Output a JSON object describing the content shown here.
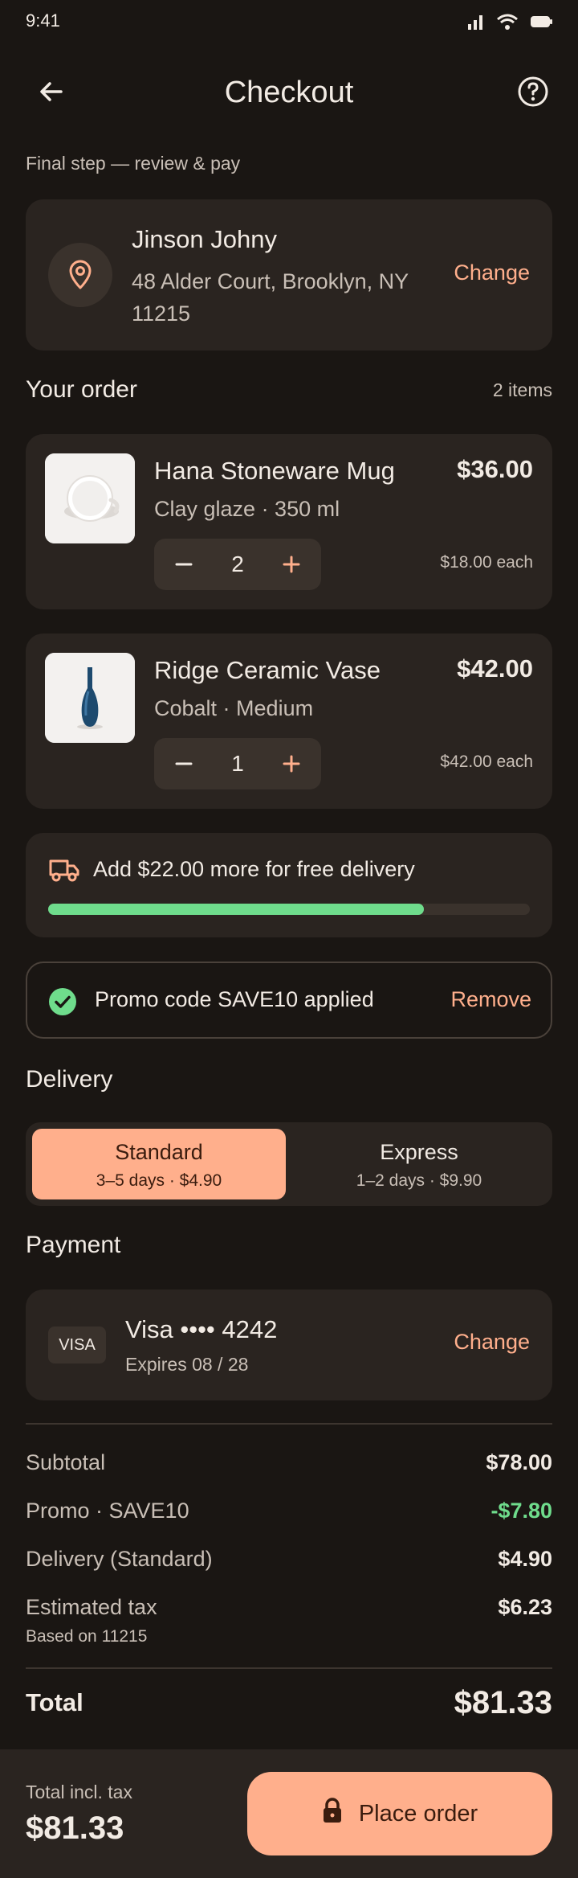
{
  "status": {
    "time": "9:41"
  },
  "header": {
    "title": "Checkout"
  },
  "subtitle": "Final step — review & pay",
  "address": {
    "name": "Jinson Johny",
    "line": "48 Alder Court, Brooklyn, NY 11215",
    "change_label": "Change"
  },
  "order": {
    "title": "Your order",
    "count_label": "2 items",
    "items": [
      {
        "name": "Hana Stoneware Mug",
        "variant": "Clay glaze · 350 ml",
        "price": "$36.00",
        "quantity": "2",
        "each": "$18.00 each",
        "image": "white-mug"
      },
      {
        "name": "Ridge Ceramic Vase",
        "variant": "Cobalt · Medium",
        "price": "$42.00",
        "quantity": "1",
        "each": "$42.00 each",
        "image": "blue-vase"
      }
    ]
  },
  "shipping_banner": {
    "text": "Add $22.00 more for free delivery",
    "progress": 0.78,
    "icon": "truck-icon"
  },
  "promo": {
    "text": "Promo code SAVE10 applied",
    "remove_label": "Remove",
    "icon": "check-circle-icon"
  },
  "delivery": {
    "title": "Delivery",
    "options": [
      {
        "label": "Standard",
        "detail": "3–5 days · $4.90",
        "selected": true
      },
      {
        "label": "Express",
        "detail": "1–2 days · $9.90",
        "selected": false
      }
    ]
  },
  "payment": {
    "title": "Payment",
    "brand": "VISA",
    "card": "Visa •••• 4242",
    "expiry": "Expires 08 / 28",
    "change_label": "Change"
  },
  "summary": {
    "subtotal_label": "Subtotal",
    "subtotal": "$78.00",
    "promo_label": "Promo · SAVE10",
    "promo": "-$7.80",
    "delivery_label": "Delivery (Standard)",
    "delivery": "$4.90",
    "tax_label": "Estimated tax",
    "tax": "$6.23",
    "tax_note": "Based on 11215",
    "total_label": "Total",
    "total": "$81.33"
  },
  "footer": {
    "label": "Total incl. tax",
    "amount": "$81.33",
    "button_label": "Place order"
  },
  "colors": {
    "accent": "#ffaf8c",
    "success": "#6fdc8c",
    "background": "#1a1613",
    "surface": "#2a2420"
  }
}
